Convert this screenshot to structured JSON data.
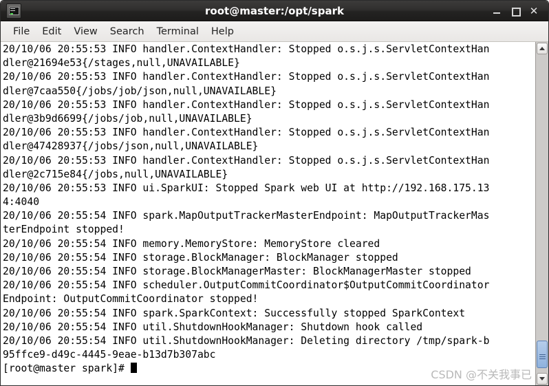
{
  "window": {
    "title": "root@master:/opt/spark",
    "icon": "terminal-icon",
    "controls": {
      "minimize": "–",
      "maximize": "□",
      "close": "✕"
    }
  },
  "menubar": {
    "items": [
      {
        "label": "File"
      },
      {
        "label": "Edit"
      },
      {
        "label": "View"
      },
      {
        "label": "Search"
      },
      {
        "label": "Terminal"
      },
      {
        "label": "Help"
      }
    ]
  },
  "terminal": {
    "lines": [
      "20/10/06 20:55:53 INFO handler.ContextHandler: Stopped o.s.j.s.ServletContextHan",
      "dler@21694e53{/stages,null,UNAVAILABLE}",
      "20/10/06 20:55:53 INFO handler.ContextHandler: Stopped o.s.j.s.ServletContextHan",
      "dler@7caa550{/jobs/job/json,null,UNAVAILABLE}",
      "20/10/06 20:55:53 INFO handler.ContextHandler: Stopped o.s.j.s.ServletContextHan",
      "dler@3b9d6699{/jobs/job,null,UNAVAILABLE}",
      "20/10/06 20:55:53 INFO handler.ContextHandler: Stopped o.s.j.s.ServletContextHan",
      "dler@47428937{/jobs/json,null,UNAVAILABLE}",
      "20/10/06 20:55:53 INFO handler.ContextHandler: Stopped o.s.j.s.ServletContextHan",
      "dler@2c715e84{/jobs,null,UNAVAILABLE}",
      "20/10/06 20:55:53 INFO ui.SparkUI: Stopped Spark web UI at http://192.168.175.13",
      "4:4040",
      "20/10/06 20:55:54 INFO spark.MapOutputTrackerMasterEndpoint: MapOutputTrackerMas",
      "terEndpoint stopped!",
      "20/10/06 20:55:54 INFO memory.MemoryStore: MemoryStore cleared",
      "20/10/06 20:55:54 INFO storage.BlockManager: BlockManager stopped",
      "20/10/06 20:55:54 INFO storage.BlockManagerMaster: BlockManagerMaster stopped",
      "20/10/06 20:55:54 INFO scheduler.OutputCommitCoordinator$OutputCommitCoordinator",
      "Endpoint: OutputCommitCoordinator stopped!",
      "20/10/06 20:55:54 INFO spark.SparkContext: Successfully stopped SparkContext",
      "20/10/06 20:55:54 INFO util.ShutdownHookManager: Shutdown hook called",
      "20/10/06 20:55:54 INFO util.ShutdownHookManager: Deleting directory /tmp/spark-b",
      "95ffce9-d49c-4445-9eae-b13d7b307abc"
    ],
    "prompt": "[root@master spark]# "
  },
  "scrollbar": {
    "up_arrow": "scroll-up-arrow",
    "down_arrow": "scroll-down-arrow",
    "thumb": "scroll-thumb"
  },
  "watermark": {
    "text": "CSDN @不关我事已"
  }
}
